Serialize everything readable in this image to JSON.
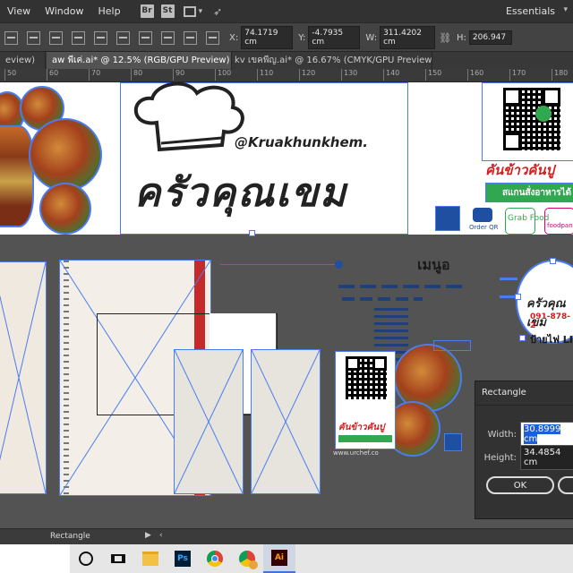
{
  "menubar": {
    "items": [
      "View",
      "Window",
      "Help"
    ],
    "bridge_icon": "Br",
    "stock_icon": "St",
    "workspace": "Essentials"
  },
  "controlbar": {
    "x_label": "X:",
    "x_value": "74.1719 cm",
    "y_label": "Y:",
    "y_value": "-4.7935 cm",
    "w_label": "W:",
    "w_value": "311.4202 cm",
    "h_label": "H:",
    "h_value": "206.947"
  },
  "tabs": [
    {
      "label": "eview)"
    },
    {
      "label": "aw พีเค่.ai* @ 12.5% (RGB/GPU Preview)"
    },
    {
      "label": "kv เขคพีญ.ai* @ 16.67% (CMYK/GPU Preview)"
    }
  ],
  "ruler": {
    "ticks": [
      "50",
      "60",
      "70",
      "80",
      "90",
      "100",
      "110",
      "120",
      "130",
      "140",
      "150",
      "160",
      "170",
      "180"
    ]
  },
  "artboard": {
    "brand_handle": "@Kruakhunkhem.",
    "brand_thai": "ครัวคุณเขม",
    "banner_red": "คันข้าวคันปู",
    "banner_green": "สแกนสั่งอาหารได้",
    "grab": "Grab Food",
    "foodpanda": "foodpanda",
    "order_qr": "Order QR",
    "menu_title": "เมนูอ",
    "phone": "091-878-2",
    "sign_label": "ป้ายไฟ LI",
    "site": "www.urchef.co",
    "qr_banner": "คันข้าวคันปู"
  },
  "dialog": {
    "title": "Rectangle",
    "width_label": "Width:",
    "width_value": "30.8999 cm",
    "height_label": "Height:",
    "height_value": "34.4854 cm",
    "ok_label": "OK"
  },
  "statusbar": {
    "tool": "Rectangle"
  },
  "taskbar": {
    "apps": [
      "search-circle-icon",
      "task-view-icon",
      "file-explorer-icon",
      "photoshop-icon",
      "chrome-icon",
      "chrome-profile-icon",
      "illustrator-icon"
    ],
    "ps_label": "Ps",
    "ai_label": "Ai"
  },
  "colors": {
    "selection": "#4a7cf0",
    "accent_red": "#d21f1f",
    "accent_green": "#2fa84f"
  }
}
